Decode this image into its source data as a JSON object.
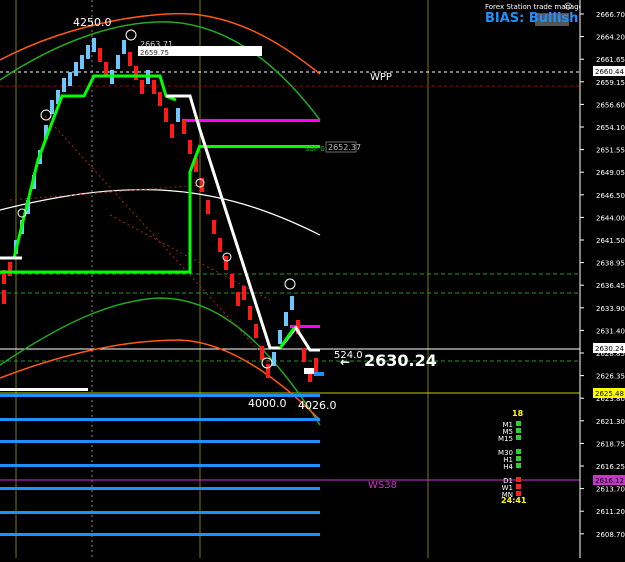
{
  "header": {
    "manager_label": "Forex Station trade manager",
    "bias_label": "BIAS: Bullish"
  },
  "price_axis": {
    "ticks": [
      "2666.70",
      "2664.20",
      "2661.65",
      "2659.15",
      "2656.60",
      "2654.10",
      "2651.55",
      "2649.05",
      "2646.50",
      "2644.00",
      "2641.50",
      "2638.95",
      "2636.45",
      "2633.90",
      "2631.40",
      "2628.85",
      "2626.35",
      "2623.80",
      "2621.30",
      "2618.75",
      "2616.25",
      "2613.70",
      "2611.20",
      "2608.70"
    ],
    "badges": [
      {
        "label": "2660.44",
        "color": "#ffffff",
        "text_color": "#000000"
      },
      {
        "label": "2630.24",
        "color": "#ffffff",
        "text_color": "#000000"
      },
      {
        "label": "2625.48",
        "color": "#ffff00",
        "text_color": "#000000"
      },
      {
        "label": "2616.12",
        "color": "#cc33cc",
        "text_color": "#000000"
      }
    ]
  },
  "annotations": {
    "high_label": "4250.0",
    "low_label_1": "4000.0",
    "low_label_2": "4026.0",
    "level_small": "2663.71",
    "level_small_2": "2659.75",
    "wpp_label": "WPP",
    "ws38_label": "WS38",
    "level_box": "2652.37",
    "level_box_prefix": "S3P 0.5",
    "count_label": "524.0",
    "current_price": "2630.24"
  },
  "timeframes": {
    "count": "18",
    "rows": [
      {
        "label": "M1",
        "color": "#33cc33"
      },
      {
        "label": "M5",
        "color": "#33cc33"
      },
      {
        "label": "M15",
        "color": "#33cc33"
      },
      {
        "label": "M30",
        "color": "#33cc33"
      },
      {
        "label": "H1",
        "color": "#33cc33"
      },
      {
        "label": "H4",
        "color": "#33cc33"
      },
      {
        "label": "D1",
        "color": "#ff2222"
      },
      {
        "label": "W1",
        "color": "#ff2222"
      },
      {
        "label": "MN",
        "color": "#ff2222"
      }
    ],
    "timer": "24:41"
  },
  "colors": {
    "up_candle": "#6ec6ff",
    "down_candle": "#ff1a1a",
    "trend_green": "#00ff00",
    "trend_white": "#ffffff",
    "level_blue": "#1e90ff",
    "level_magenta": "#ff00ff",
    "ma_orange": "#ff5a14",
    "ma_green": "#22aa22"
  }
}
